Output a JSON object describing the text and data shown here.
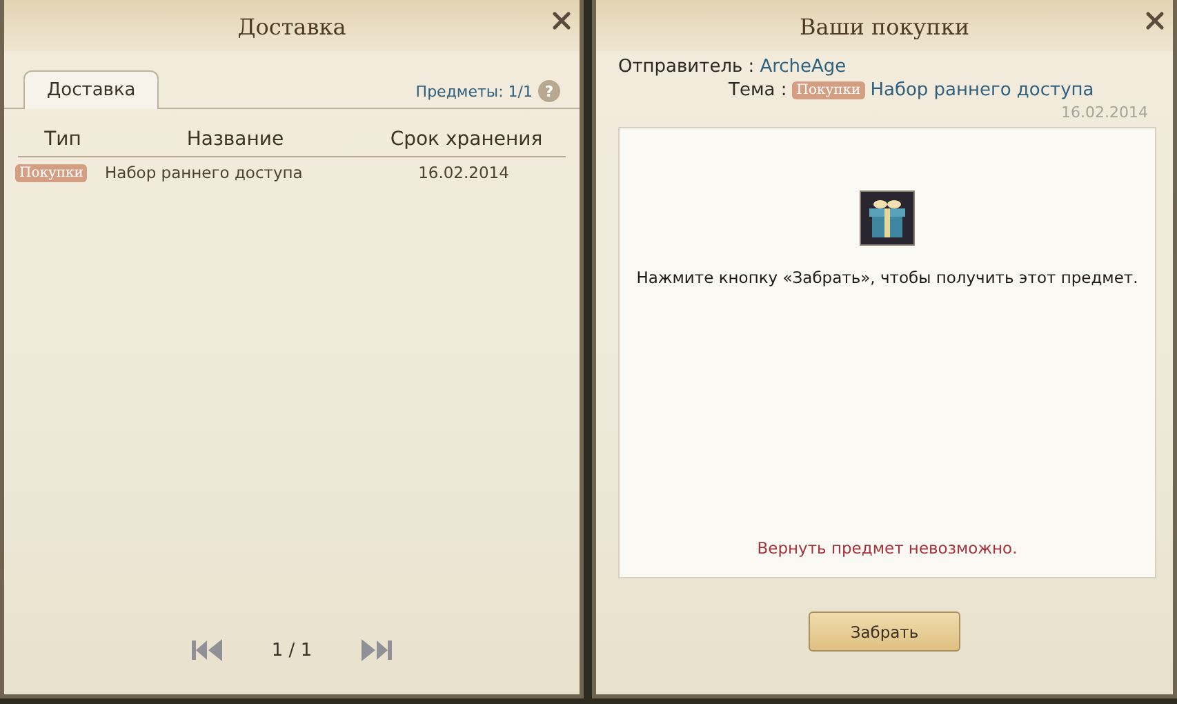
{
  "delivery_window": {
    "title": "Доставка",
    "tabs": [
      {
        "label": "Доставка",
        "selected": true
      }
    ],
    "items_count": "Предметы: 1/1",
    "help": "?",
    "columns": [
      "Тип",
      "Название",
      "Срок хранения"
    ],
    "rows": [
      {
        "type": "Покупки",
        "name": "Набор раннего доступа",
        "expiry": "16.02.2014",
        "selected": false
      }
    ],
    "pager": {
      "page": "1 / 1"
    }
  },
  "message_window": {
    "title": "Ваши покупки",
    "sender_label": "Отправитель :",
    "sender": "ArcheAge",
    "subject_label": "Тема :",
    "subject_tag": "Покупки",
    "subject": "Набор раннего доступа",
    "date": "16.02.2014",
    "body": "Нажмите кнопку «Забрать», чтобы получить этот предмет.",
    "warning": "Вернуть предмет невозможно.",
    "button": "Забрать"
  }
}
